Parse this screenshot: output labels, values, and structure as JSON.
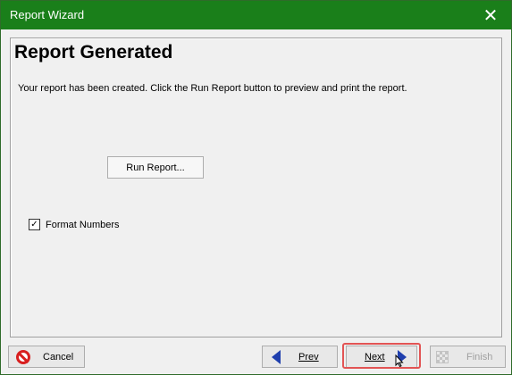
{
  "window": {
    "title": "Report Wizard",
    "close_glyph": "✕",
    "title_bar_color": "#1a7f1a"
  },
  "panel": {
    "heading": "Report Generated",
    "description": "Your report has been created.  Click the Run Report button to preview and print the report.",
    "run_report_label": "Run Report...",
    "format_numbers": {
      "label": "Format Numbers",
      "checked": true,
      "check_glyph": "✓"
    }
  },
  "footer": {
    "cancel_label": "Cancel",
    "prev_label": "Prev",
    "next_label": "Next",
    "finish_label": "Finish",
    "highlight_color": "#e25454"
  },
  "icons": {
    "cancel": "cancel-icon",
    "prev": "arrow-left-icon",
    "next": "arrow-right-icon",
    "finish": "checkered-flag-icon",
    "cursor": "mouse-pointer-icon"
  }
}
